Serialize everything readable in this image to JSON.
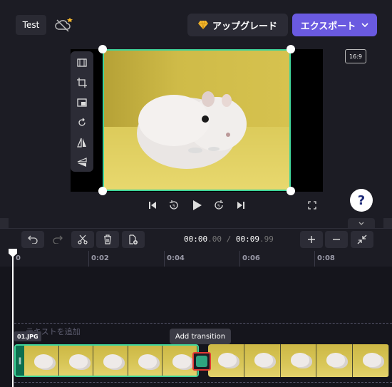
{
  "header": {
    "project_title": "Test",
    "upgrade_label": "アップグレード",
    "export_label": "エクスポート"
  },
  "preview": {
    "aspect_ratio": "16:9"
  },
  "help": {
    "label": "?"
  },
  "timeline": {
    "current_time_main": "00:00",
    "current_time_frac": ".00",
    "separator": " / ",
    "duration_main": "00:09",
    "duration_frac": ".99",
    "ticks": [
      "0",
      "0:02",
      "0:04",
      "0:06",
      "0:08"
    ],
    "text_track_placeholder": "テキストを追加",
    "clip_name": "01.JPG",
    "tooltip": "Add transition"
  },
  "colors": {
    "accent": "#6a5ae0",
    "selection": "#3fd49a",
    "highlight": "#e53935"
  }
}
